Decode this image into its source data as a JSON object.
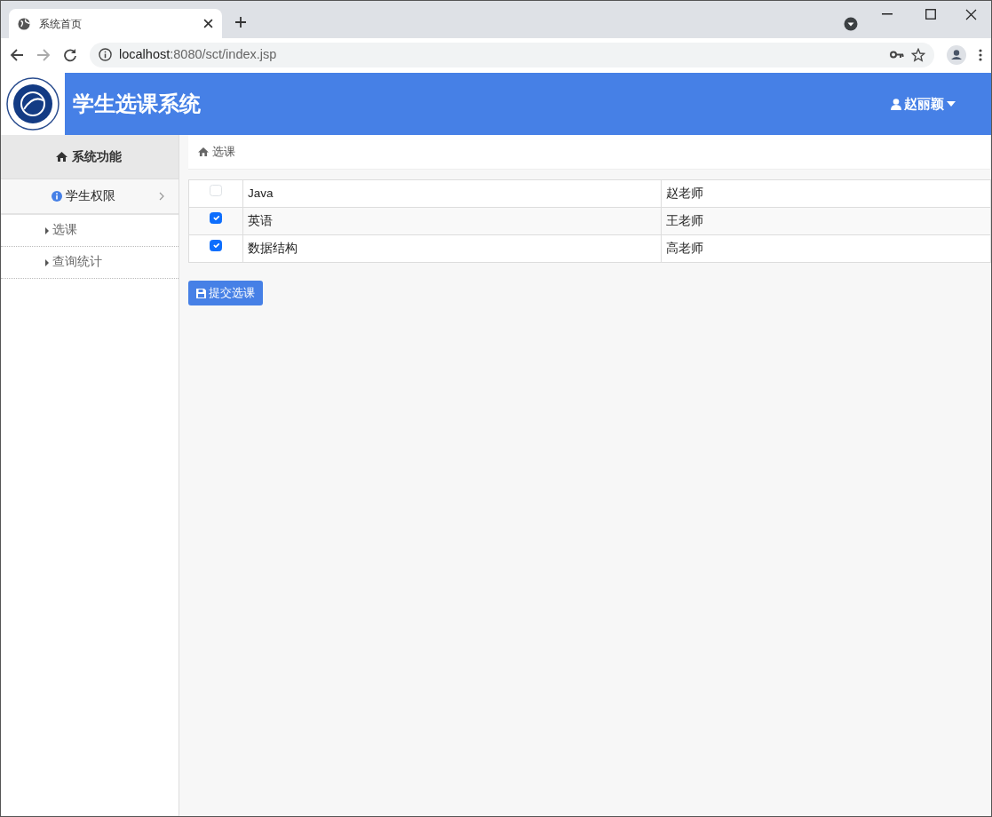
{
  "browser": {
    "tab_title": "系统首页",
    "url_host": "localhost",
    "url_path": ":8080/sct/index.jsp"
  },
  "header": {
    "title": "学生选课系统",
    "user": "赵丽颖"
  },
  "sidebar": {
    "heading": "系统功能",
    "group": {
      "label": "学生权限",
      "expanded": true
    },
    "items": [
      {
        "label": "选课"
      },
      {
        "label": "查询统计"
      }
    ]
  },
  "breadcrumb": "选课",
  "courses": [
    {
      "name": "Java",
      "teacher": "赵老师",
      "checked": false
    },
    {
      "name": "英语",
      "teacher": "王老师",
      "checked": true
    },
    {
      "name": "数据结构",
      "teacher": "高老师",
      "checked": true
    }
  ],
  "submit_button": "提交选课"
}
